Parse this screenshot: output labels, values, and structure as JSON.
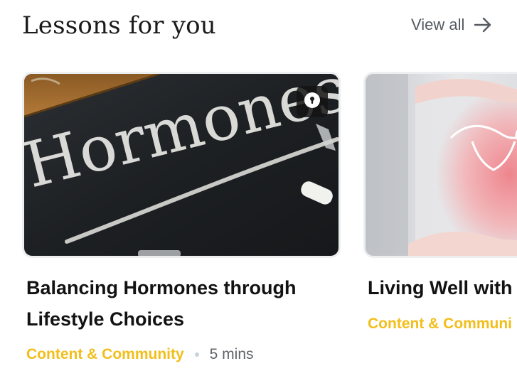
{
  "header": {
    "title": "Lessons for you",
    "view_all_label": "View all"
  },
  "lessons": [
    {
      "title_line1": "Balancing Hormones through",
      "title_line2": "Lifestyle Choices",
      "image_chalk_text": "Hormones",
      "category": "Content & Community",
      "duration": "5 mins",
      "locked": true
    },
    {
      "title_line1": "Living Well with",
      "category": "Content & Communi"
    }
  ],
  "colors": {
    "category": "#f2be1a",
    "title": "#121212",
    "muted": "#5f6368"
  },
  "icons": {
    "view_all": "arrow-right-icon",
    "locked": "lock-icon"
  }
}
